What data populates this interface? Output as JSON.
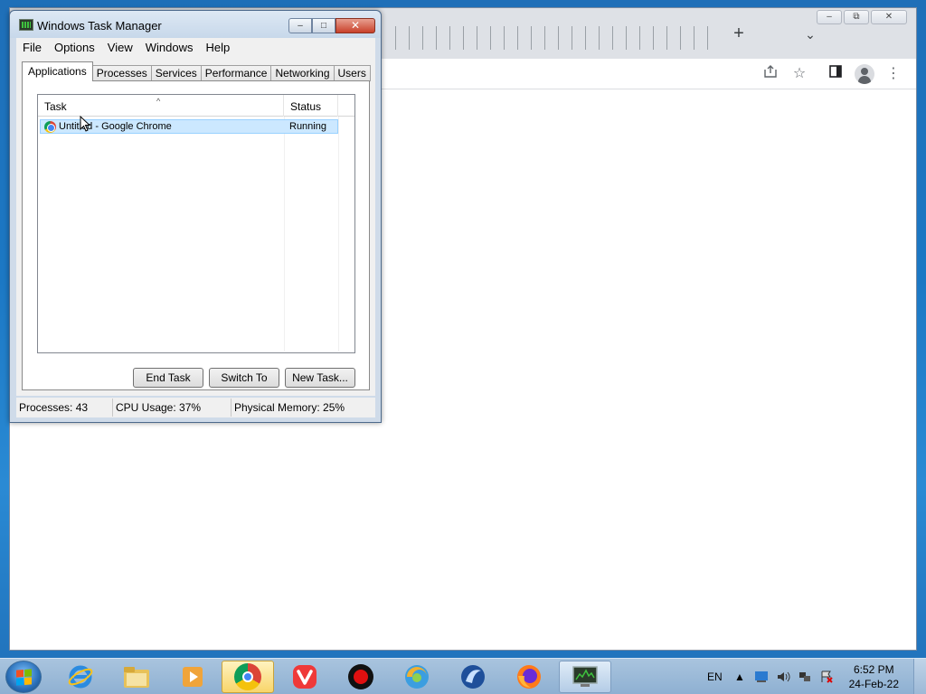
{
  "chrome": {
    "new_tab": "+",
    "tab_search": "⌄"
  },
  "task_manager": {
    "title": "Windows Task Manager",
    "window_buttons": {
      "minimize": "–",
      "maximize": "□",
      "close": "✕"
    },
    "menu": [
      "File",
      "Options",
      "View",
      "Windows",
      "Help"
    ],
    "tabs": [
      "Applications",
      "Processes",
      "Services",
      "Performance",
      "Networking",
      "Users"
    ],
    "active_tab": "Applications",
    "columns": {
      "task": "Task",
      "status": "Status"
    },
    "rows": [
      {
        "task": "Untitled - Google Chrome",
        "status": "Running"
      }
    ],
    "buttons": {
      "end_task": "End Task",
      "switch_to": "Switch To",
      "new_task": "New Task..."
    },
    "status_bar": {
      "processes": "Processes: 43",
      "cpu": "CPU Usage: 37%",
      "memory": "Physical Memory: 25%"
    }
  },
  "taskbar": {
    "apps": [
      "Internet Explorer",
      "Windows Explorer",
      "Media Player",
      "Google Chrome",
      "Vivaldi",
      "Screen Recorder",
      "Waterfox",
      "SeaMonkey",
      "Firefox",
      "Task Manager"
    ],
    "language": "EN",
    "time": "6:52 PM",
    "date": "24-Feb-22"
  }
}
